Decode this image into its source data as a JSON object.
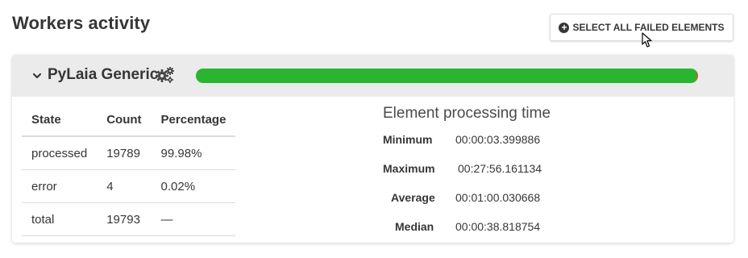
{
  "page": {
    "title": "Workers activity"
  },
  "actions": {
    "select_failed_label": "SELECT ALL FAILED ELEMENTS"
  },
  "worker": {
    "name": "PyLaia Generic",
    "progress": {
      "processed_fraction": 0.9998,
      "error_fraction": 0.0002
    },
    "colors": {
      "processed": "#29b52f",
      "error": "#d9541e"
    }
  },
  "states_table": {
    "headers": [
      "State",
      "Count",
      "Percentage"
    ],
    "rows": [
      {
        "state": "processed",
        "count": "19789",
        "percentage": "99.98%"
      },
      {
        "state": "error",
        "count": "4",
        "percentage": "0.02%"
      },
      {
        "state": "total",
        "count": "19793",
        "percentage": "—"
      }
    ]
  },
  "processing_time": {
    "title": "Element processing time",
    "rows": [
      {
        "label": "Minimum",
        "value": "00:00:03.399886"
      },
      {
        "label": "Maximum",
        "value": "00:27:56.161134"
      },
      {
        "label": "Average",
        "value": "00:01:00.030668"
      },
      {
        "label": "Median",
        "value": "00:00:38.818754"
      }
    ]
  },
  "icons": [
    "plus-circle-icon",
    "chevron-down-icon",
    "gears-icon",
    "mouse-cursor-icon"
  ]
}
